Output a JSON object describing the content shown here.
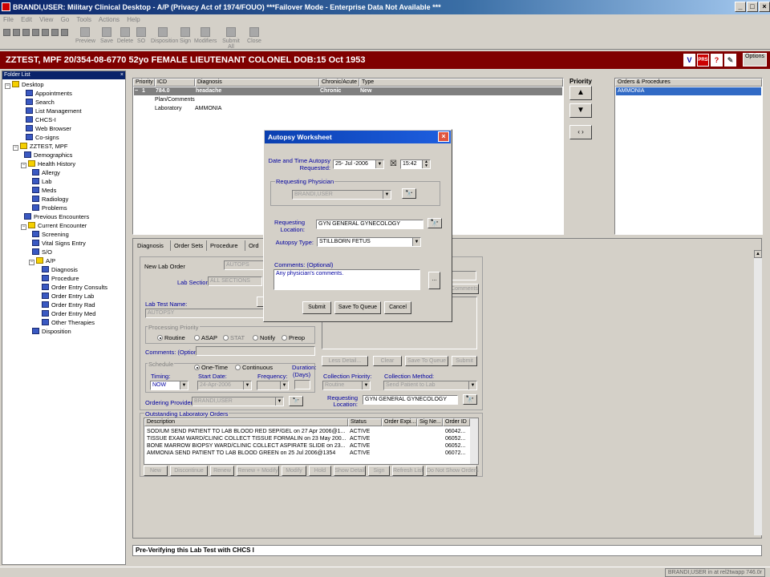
{
  "window": {
    "title": "BRANDI,USER: Military Clinical Desktop - A/P (Privacy Act of 1974/FOUO) ***Failover Mode - Enterprise Data Not Available ***",
    "min": "_",
    "max": "□",
    "close": "×"
  },
  "menu": [
    "File",
    "Edit",
    "View",
    "Go",
    "Tools",
    "Actions",
    "Help"
  ],
  "toolbar": [
    "Preview",
    "Save",
    "Delete",
    "SO",
    "Disposition",
    "Sign",
    "Modifiers",
    "Submit All",
    "Close"
  ],
  "patient": {
    "banner": "ZZTEST, MPF  20/354-08-6770  52yo  FEMALE  LIEUTENANT COLONEL  DOB:15 Oct 1953",
    "options_label": "Options",
    "icon_v": "V",
    "icon_prs": "PRS"
  },
  "folder_list": {
    "title": "Folder List",
    "items": [
      "Desktop",
      "Appointments",
      "Search",
      "List Management",
      "CHCS-I",
      "Web Browser",
      "Co-signs",
      "ZZTEST, MPF",
      "Demographics",
      "Health History",
      "Allergy",
      "Lab",
      "Meds",
      "Radiology",
      "Problems",
      "Previous Encounters",
      "Current Encounter",
      "Screening",
      "Vital Signs Entry",
      "S/O",
      "A/P",
      "Diagnosis",
      "Procedure",
      "Order Entry Consults",
      "Order Entry Lab",
      "Order Entry Rad",
      "Order Entry Med",
      "Other Therapies",
      "Disposition"
    ]
  },
  "problems": {
    "headers": [
      "Priority",
      "ICD",
      "Diagnosis",
      "Chronic/Acute",
      "Type"
    ],
    "row": {
      "priority": "1",
      "icd": "784.0",
      "diagnosis": "headache",
      "chronic": "Chronic",
      "type": "New"
    },
    "sub1": "Plan/Comments",
    "sub2_label": "Laboratory",
    "sub2_value": "AMMONIA"
  },
  "priority_panel": {
    "title": "Priority",
    "up": "▲",
    "down": "▼",
    "swap": "‹ ›"
  },
  "orders": {
    "header": "Orders & Procedures",
    "items": [
      "AMMONIA"
    ]
  },
  "tabs": [
    "Diagnosis",
    "Order Sets",
    "Procedure",
    "Ord"
  ],
  "lab_form": {
    "new_lab_order": "New Lab Order",
    "new_lab_order_value": "AUTOPS",
    "lab_section": "Lab Section:",
    "lab_section_value": "ALL SECTIONS",
    "lab_test_name": "Lab Test Name:",
    "lab_test_value": "AUTOPSY",
    "processing_priority": "Processing Priority",
    "priorities": [
      "Routine",
      "ASAP",
      "STAT",
      "Notify",
      "Preop"
    ],
    "comments": "Comments: (Optional)",
    "schedule": "Schedule",
    "one_time": "One-Time",
    "continuous": "Continuous",
    "duration": "Duration:",
    "days": "(Days)",
    "timing": "Timing:",
    "timing_value": "NOW",
    "start_date": "Start Date:",
    "start_date_value": "24-Apr-2006",
    "frequency": "Frequency:",
    "ordering_provider": "Ordering Provider:",
    "ordering_provider_value": "BRANDI,USER",
    "right_comments": "Comments",
    "less_detail": "Less Detail...",
    "clear": "Clear",
    "save_to_queue": "Save To Queue",
    "submit": "Submit",
    "collection_priority": "Collection Priority:",
    "collection_priority_value": "Routine",
    "collection_method": "Collection Method:",
    "collection_method_value": "Send Patient to Lab",
    "requesting_location": "Requesting\nLocation:",
    "requesting_location_value": "GYN GENERAL GYNECOLOGY"
  },
  "outstanding": {
    "title": "Outstanding Laboratory Orders",
    "headers": [
      "Description",
      "Status",
      "Order Expi...",
      "Sig Ne...",
      "Order ID"
    ],
    "rows": [
      {
        "desc": "SODIUM   SEND PATIENT TO LAB   BLOOD   RED SEP/GEL   on 27 Apr 2006@1...",
        "status": "ACTIVE",
        "id": "06042..."
      },
      {
        "desc": "TISSUE EXAM   WARD/CLINIC COLLECT   TISSUE   FORMALIN   on 23 May 200...",
        "status": "ACTIVE",
        "id": "06052..."
      },
      {
        "desc": "BONE MARROW BIOPSY   WARD/CLINIC COLLECT   ASPIRATE   SLIDE   on 23...",
        "status": "ACTIVE",
        "id": "06052..."
      },
      {
        "desc": "AMMONIA   SEND PATIENT TO LAB   BLOOD   GREEN   on 25 Jul 2006@1354",
        "status": "ACTIVE",
        "id": "06072..."
      }
    ],
    "buttons": [
      "New",
      "Discontinue",
      "Renew",
      "Renew + Modify",
      "Modify",
      "Hold",
      "Show Detail",
      "Sign",
      "Refresh List",
      "Do Not Show Orders"
    ]
  },
  "status": "Pre-Verifying this Lab Test with CHCS I",
  "bottom": "BRANDI,USER in  at rel2twapp 746.0r",
  "dialog": {
    "title": "Autopsy Worksheet",
    "date_label": "Date and Time Autopsy\nRequested:",
    "date_value": "25- Jul -2006",
    "time_value": "15:42",
    "checkbox_mark": "☒",
    "req_physician": "Requesting Physician",
    "req_physician_value": "BRANDI,USER",
    "req_location_label": "Requesting\nLocation:",
    "req_location_value": "GYN GENERAL GYNECOLOGY",
    "autopsy_type_label": "Autopsy Type:",
    "autopsy_type_value": "STILLBORN FETUS",
    "comments_label": "Comments:  (Optional)",
    "comments_value": "Any physician's comments.",
    "ellipsis": "...",
    "submit": "Submit",
    "save_to_queue": "Save To Queue",
    "cancel": "Cancel",
    "binoc": "🔭"
  }
}
